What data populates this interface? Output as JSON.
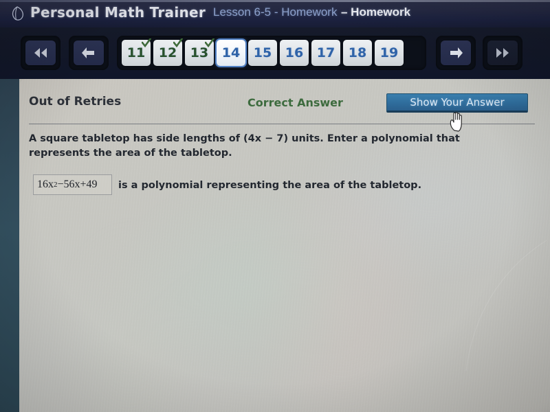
{
  "app": {
    "title": "Personal Math Trainer",
    "logo_icon": "leaf-droplet-logo-icon",
    "lesson_label": "Lesson 6-5 - Homework",
    "lesson_suffix": "– Homework"
  },
  "nav": {
    "rewind_icon": "rewind-double-left-icon",
    "back_icon": "arrow-left-icon",
    "forward_icon": "arrow-right-icon",
    "fast_forward_icon": "fast-forward-double-right-icon",
    "pages": [
      {
        "number": "11",
        "state": "completed"
      },
      {
        "number": "12",
        "state": "completed"
      },
      {
        "number": "13",
        "state": "completed"
      },
      {
        "number": "14",
        "state": "current"
      },
      {
        "number": "15",
        "state": "normal"
      },
      {
        "number": "16",
        "state": "normal"
      },
      {
        "number": "17",
        "state": "normal"
      },
      {
        "number": "18",
        "state": "normal"
      },
      {
        "number": "19",
        "state": "normal"
      }
    ]
  },
  "content": {
    "status_label": "Out of Retries",
    "correct_answer_label": "Correct Answer",
    "show_answer_button": "Show Your Answer",
    "question": "A square tabletop has side lengths of (4x − 7) units. Enter a polynomial that represents the area of the tabletop.",
    "answer_value_base": "16x",
    "answer_value_exponent": "2",
    "answer_value_rest": "−56x+49",
    "answer_suffix": "is a polynomial representing the area of the tabletop."
  },
  "cursor": {
    "icon": "pointing-hand-cursor"
  },
  "colors": {
    "titlebar": "#1f2440",
    "accent_blue": "#2f6d9c",
    "page_number_blue": "#2f63a8",
    "completed_green": "#28512c",
    "correct_green": "#3d6b3e",
    "content_bg": "#c6c7c3",
    "left_strip": "#33505f"
  }
}
